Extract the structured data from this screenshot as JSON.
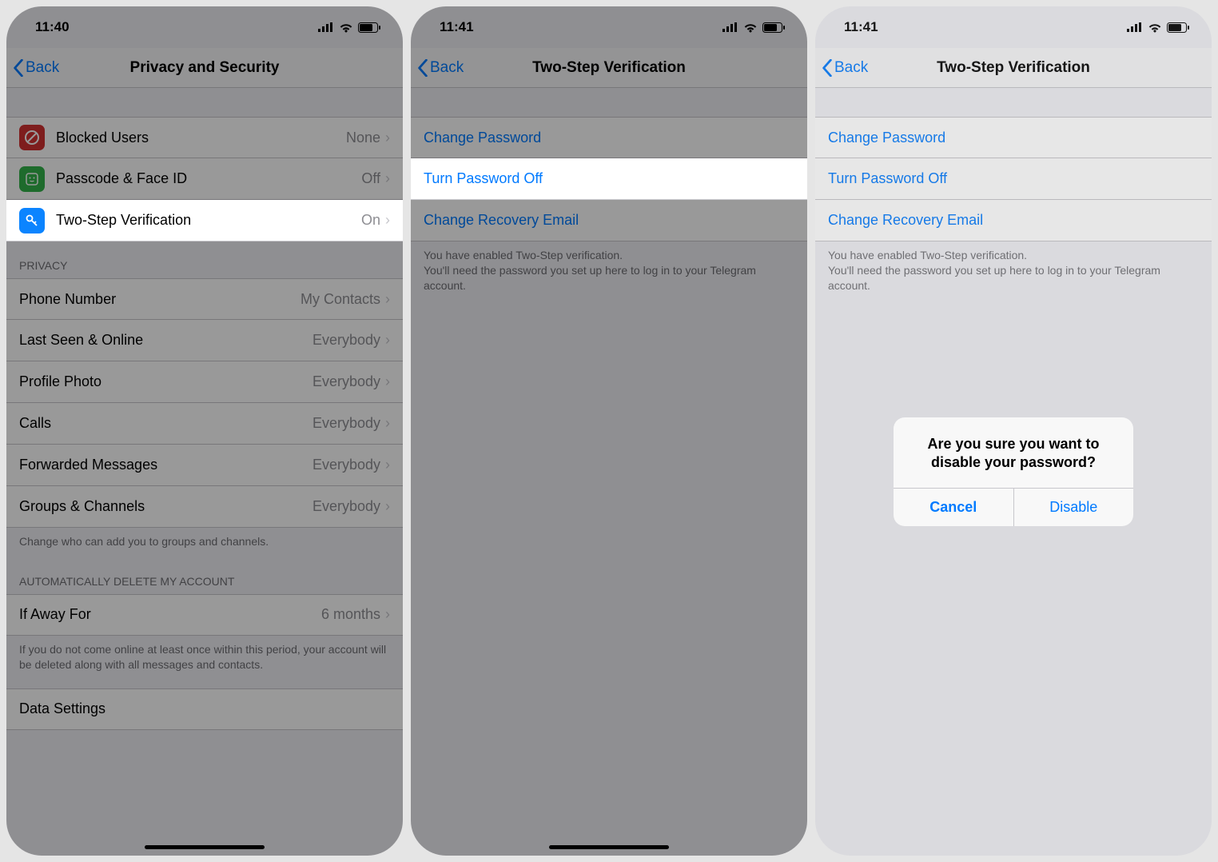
{
  "screen1": {
    "time": "11:40",
    "nav_back": "Back",
    "nav_title": "Privacy and Security",
    "security_rows": [
      {
        "label": "Blocked Users",
        "value": "None",
        "icon_bg": "#d33131",
        "icon_glyph": "⊘"
      },
      {
        "label": "Passcode & Face ID",
        "value": "Off",
        "icon_bg": "#32b24a",
        "icon_glyph": "🙂"
      },
      {
        "label": "Two-Step Verification",
        "value": "On",
        "icon_bg": "#0b84ff",
        "icon_glyph": "🔑"
      }
    ],
    "privacy_header": "PRIVACY",
    "privacy_rows": [
      {
        "label": "Phone Number",
        "value": "My Contacts"
      },
      {
        "label": "Last Seen & Online",
        "value": "Everybody"
      },
      {
        "label": "Profile Photo",
        "value": "Everybody"
      },
      {
        "label": "Calls",
        "value": "Everybody"
      },
      {
        "label": "Forwarded Messages",
        "value": "Everybody"
      },
      {
        "label": "Groups & Channels",
        "value": "Everybody"
      }
    ],
    "privacy_footer": "Change who can add you to groups and channels.",
    "auto_delete_header": "AUTOMATICALLY DELETE MY ACCOUNT",
    "auto_delete_row": {
      "label": "If Away For",
      "value": "6 months"
    },
    "auto_delete_footer": "If you do not come online at least once within this period, your account will be deleted along with all messages and contacts.",
    "data_settings": "Data Settings"
  },
  "screen2": {
    "time": "11:41",
    "nav_back": "Back",
    "nav_title": "Two-Step Verification",
    "rows": [
      "Change Password",
      "Turn Password Off",
      "Change Recovery Email"
    ],
    "footer": "You have enabled Two-Step verification.\nYou'll need the password you set up here to log in to your Telegram account."
  },
  "screen3": {
    "time": "11:41",
    "nav_back": "Back",
    "nav_title": "Two-Step Verification",
    "rows": [
      "Change Password",
      "Turn Password Off",
      "Change Recovery Email"
    ],
    "footer": "You have enabled Two-Step verification.\nYou'll need the password you set up here to log in to your Telegram account.",
    "alert_title": "Are you sure you want to disable your password?",
    "alert_cancel": "Cancel",
    "alert_disable": "Disable"
  }
}
